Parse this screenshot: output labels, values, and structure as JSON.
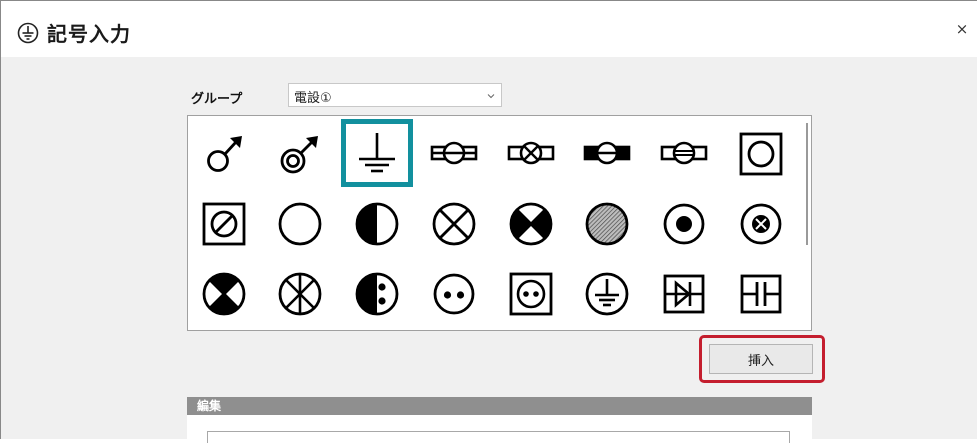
{
  "window": {
    "title": "記号入力",
    "close_label": "×"
  },
  "group": {
    "label": "グループ",
    "selected": "電設①"
  },
  "symbols": [
    {
      "icon": "male-symbol-icon"
    },
    {
      "icon": "double-circle-arrow-icon"
    },
    {
      "icon": "ground-icon",
      "selected": true
    },
    {
      "icon": "fluorescent-lamp-icon"
    },
    {
      "icon": "fluorescent-lamp-x-icon"
    },
    {
      "icon": "fluorescent-lamp-filled-icon"
    },
    {
      "icon": "fluorescent-lamp-striped-icon"
    },
    {
      "icon": "square-circle-icon"
    },
    {
      "icon": "square-slashed-circle-icon"
    },
    {
      "icon": "circle-icon"
    },
    {
      "icon": "half-filled-circle-icon"
    },
    {
      "icon": "circle-x-icon"
    },
    {
      "icon": "circle-x-filled-icon"
    },
    {
      "icon": "hatched-circle-icon"
    },
    {
      "icon": "circle-dot-icon"
    },
    {
      "icon": "circle-small-x-icon"
    },
    {
      "icon": "circle-x-filled-lr-icon"
    },
    {
      "icon": "circle-asterisk-icon"
    },
    {
      "icon": "circle-half-dots-icon"
    },
    {
      "icon": "circle-two-dots-icon"
    },
    {
      "icon": "square-outlet-icon"
    },
    {
      "icon": "circle-ground-icon"
    },
    {
      "icon": "boxed-diode-icon"
    },
    {
      "icon": "boxed-capacitor-icon"
    }
  ],
  "insert_label": "挿入",
  "edit": {
    "header": "編集"
  }
}
